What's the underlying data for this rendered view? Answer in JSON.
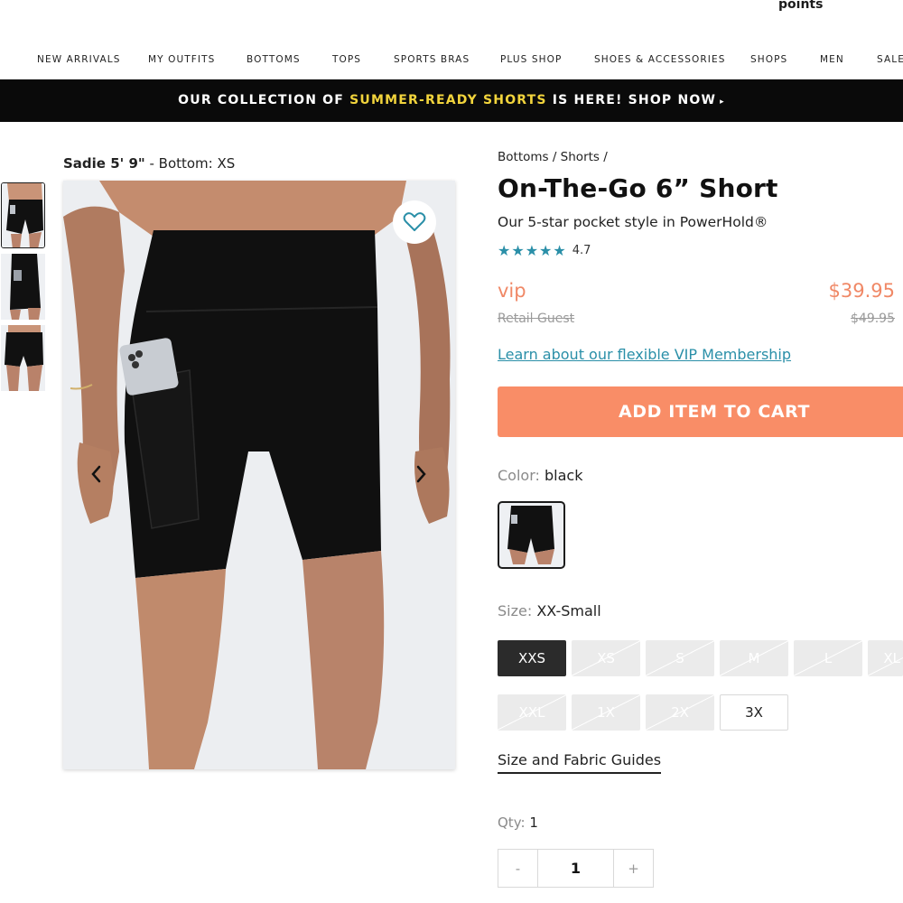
{
  "header": {
    "points_label": "points"
  },
  "nav": {
    "items": [
      "NEW ARRIVALS",
      "MY OUTFITS",
      "BOTTOMS",
      "TOPS",
      "SPORTS BRAS",
      "PLUS SHOP",
      "SHOES & ACCESSORIES",
      "SHOPS",
      "MEN",
      "SALE"
    ]
  },
  "promo": {
    "prefix": "OUR COLLECTION OF ",
    "highlight": "SUMMER-READY SHORTS",
    "suffix": " IS HERE! SHOP NOW",
    "arrow_glyph": "▸",
    "highlight_color": "#f2d43c"
  },
  "gallery": {
    "model_name": "Sadie 5' 9\"",
    "model_size": " - Bottom: XS",
    "thumbnail_count": 3,
    "selected_thumbnail": 1,
    "prev_arrow": "‹",
    "next_arrow": "›"
  },
  "product": {
    "breadcrumb": "Bottoms / Shorts /",
    "title": "On-The-Go 6” Short",
    "subtitle": "Our 5-star pocket style in PowerHold®",
    "stars": "★★★★★",
    "rating": "4.7",
    "vip_label": "vip",
    "vip_price": "$39.95",
    "retail_label": "Retail Guest",
    "retail_price": "$49.95",
    "vip_link": "Learn about our flexible VIP Membership",
    "add_to_cart": "ADD ITEM TO CART",
    "accent_color": "#f98d67",
    "link_color": "#2a8fa8"
  },
  "color": {
    "label": "Color:",
    "value": "black"
  },
  "size": {
    "label": "Size:",
    "value": "XX-Small",
    "options": [
      {
        "label": "XXS",
        "state": "selected"
      },
      {
        "label": "XS",
        "state": "unavailable"
      },
      {
        "label": "S",
        "state": "unavailable"
      },
      {
        "label": "M",
        "state": "unavailable"
      },
      {
        "label": "L",
        "state": "unavailable"
      },
      {
        "label": "XL",
        "state": "unavailable"
      },
      {
        "label": "XXL",
        "state": "unavailable"
      },
      {
        "label": "1X",
        "state": "unavailable"
      },
      {
        "label": "2X",
        "state": "unavailable"
      },
      {
        "label": "3X",
        "state": "available"
      }
    ],
    "guides_link": "Size and Fabric Guides"
  },
  "quantity": {
    "label": "Qty:",
    "value": "1",
    "minus": "-",
    "plus": "+"
  }
}
